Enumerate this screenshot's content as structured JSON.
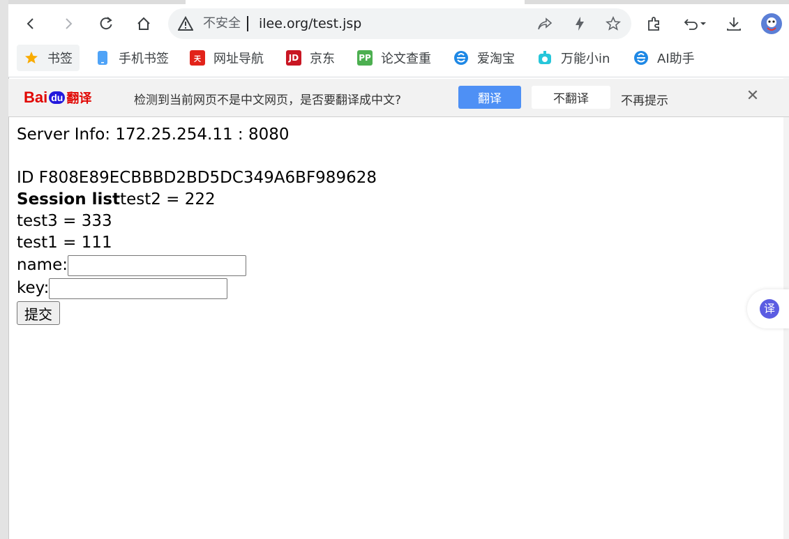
{
  "browser": {
    "omnibox": {
      "insecure_label": "不安全",
      "url": "ilee.org/test.jsp"
    },
    "bookmarks": [
      {
        "label": "书签",
        "icon": "star-icon",
        "color": "#f9ab00"
      },
      {
        "label": "手机书签",
        "icon": "phone-icon",
        "color": "#4fa3f7"
      },
      {
        "label": "网址导航",
        "icon": "tianji-nav-icon",
        "color": "#e2231a"
      },
      {
        "label": "京东",
        "icon": "jd-icon",
        "color": "#c91623"
      },
      {
        "label": "论文查重",
        "icon": "pp-icon",
        "color": "#4caf50"
      },
      {
        "label": "爱淘宝",
        "icon": "e-browser-icon",
        "color": "#1e88e5"
      },
      {
        "label": "万能小in",
        "icon": "robot-icon",
        "color": "#26c6da"
      },
      {
        "label": "AI助手",
        "icon": "e-browser-icon",
        "color": "#1e88e5"
      }
    ],
    "translate_bar": {
      "logo_text_bai": "Bai",
      "logo_text_du": "du",
      "logo_text_cn": "翻译",
      "message": "检测到当前网页不是中文网页，是否要翻译成中文?",
      "translate_button": "翻译",
      "no_translate_button": "不翻译",
      "never_link": "不再提示",
      "close_symbol": "✕"
    },
    "float_translate_glyph": "译"
  },
  "page": {
    "server_info": "Server Info: 172.25.254.11 : 8080",
    "session_id": "ID F808E89ECBBBD2BD5DC349A6BF989628",
    "session_list_label": "Session list",
    "session_items": [
      "test2 = 222",
      "test3 = 333",
      "test1 = 111"
    ],
    "name_label": "name:",
    "key_label": "key:",
    "submit_label": "提交"
  }
}
